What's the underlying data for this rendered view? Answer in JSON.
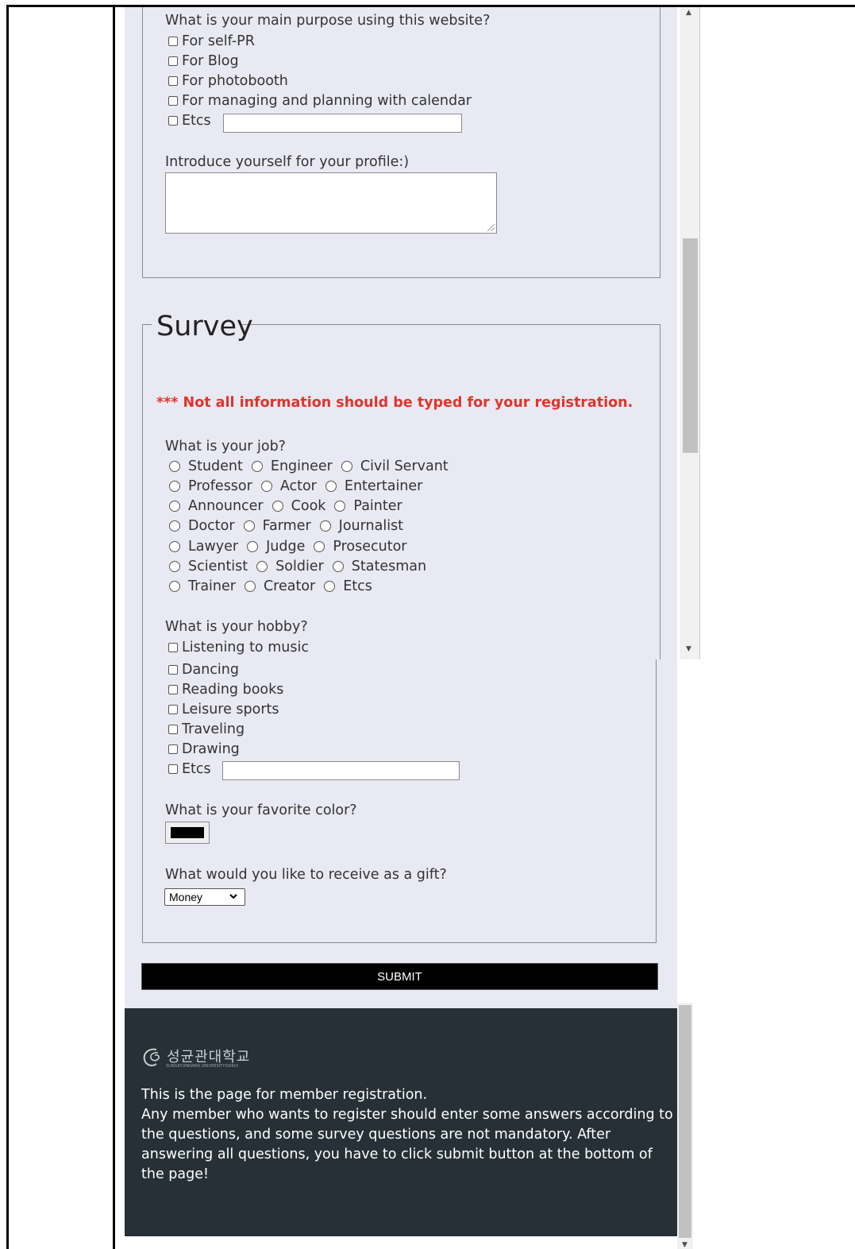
{
  "purpose": {
    "question": "What is your main purpose using this website?",
    "options": [
      "For self-PR",
      "For Blog",
      "For photobooth",
      "For managing and planning with calendar",
      "Etcs"
    ]
  },
  "profile": {
    "question": "Introduce yourself for your profile:)"
  },
  "survey": {
    "legend": "Survey",
    "notice": "*** Not all information should be typed for your registration.",
    "job_question": "What is your job?",
    "jobs": [
      [
        "Student",
        "Engineer",
        "Civil Servant"
      ],
      [
        "Professor",
        "Actor",
        "Entertainer"
      ],
      [
        "Announcer",
        "Cook",
        "Painter"
      ],
      [
        "Doctor",
        "Farmer",
        "Journalist"
      ],
      [
        "Lawyer",
        "Judge",
        "Prosecutor"
      ],
      [
        "Scientist",
        "Soldier",
        "Statesman"
      ],
      [
        "Trainer",
        "Creator",
        "Etcs"
      ]
    ],
    "hobby_question": "What is your hobby?",
    "hobbies": [
      "Listening to music",
      "Dancing",
      "Reading books",
      "Leisure sports",
      "Traveling",
      "Drawing",
      "Etcs"
    ],
    "color_question": "What is your favorite color?",
    "favorite_color": "#000000",
    "gift_question": "What would you like to receive as a gift?",
    "gift_selected": "Money"
  },
  "submit_label": "SUBMIT",
  "footer": {
    "logo_text": "성균관대학교",
    "logo_subtext": "SUNGKYUNKWAN UNIVERSITY(SKKU)",
    "lines": [
      "This is the page for member registration.",
      "Any member who wants to register should enter some answers according to",
      "the questions, and some survey questions are not mandatory. After",
      "answering all questions, you have to click submit button at the bottom of",
      "the page!"
    ]
  },
  "colors": {
    "footer_bg": "#263036",
    "notice": "#e0352b",
    "page_bg": "#e9e9f3"
  }
}
